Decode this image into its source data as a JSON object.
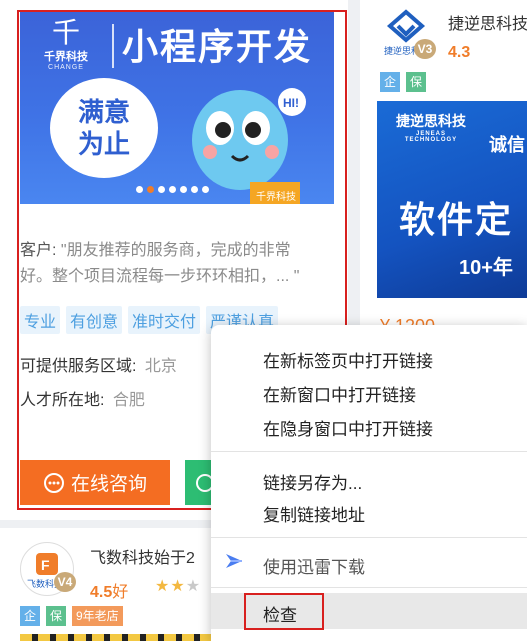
{
  "left_card": {
    "banner": {
      "logo_glyph": "千",
      "logo_name": "千界科技",
      "logo_en": "CHANGE",
      "title": "小程序开发",
      "bubble_line1": "满意",
      "bubble_line2": "为止",
      "mascot_hi": "HI!",
      "mascot_shirt": "千界科技"
    },
    "client_label": "客户:",
    "client_quote_line1": "\"朋友推荐的服务商，完成的非常",
    "client_quote_line2": "好。整个项目流程每一步环环相扣，... \"",
    "tags": [
      "专业",
      "有创意",
      "准时交付",
      "严谨认真"
    ],
    "service_area_label": "可提供服务区域:",
    "service_area_value": "北京",
    "talent_location_label": "人才所在地:",
    "talent_location_value": "合肥",
    "consult_button_label": "在线咨询",
    "consult_icon": "chat-icon"
  },
  "right_card": {
    "company_name": "捷逆思科技",
    "level_badge": "V3",
    "rating": "4.3",
    "badges": [
      "企",
      "保"
    ],
    "banner": {
      "logo_text": "捷逆思科技",
      "logo_en": "JENEAS TECHNOLOGY",
      "slogan": "诚信",
      "headline": "软件定",
      "year_text": "10+年"
    },
    "price": "¥ 1200"
  },
  "bottom_card": {
    "company_name": "飞数科技始于2",
    "logo_text": "飞数科技",
    "level_badge": "V4",
    "rating": "4.5",
    "rating_suffix": "好",
    "stars": "★★",
    "stars_grey": "★",
    "badges": [
      "企",
      "保"
    ],
    "age_badge": "9年老店"
  },
  "context_menu": {
    "items": [
      "在新标签页中打开链接",
      "在新窗口中打开链接",
      "在隐身窗口中打开链接",
      "链接另存为...",
      "复制链接地址",
      "使用迅雷下载",
      "检查"
    ],
    "thunder_icon": "thunder-icon"
  },
  "colors": {
    "accent_orange": "#f46d22",
    "highlight_red": "#d8201f",
    "tag_blue": "#4d9fe0",
    "green": "#2dbd73"
  }
}
